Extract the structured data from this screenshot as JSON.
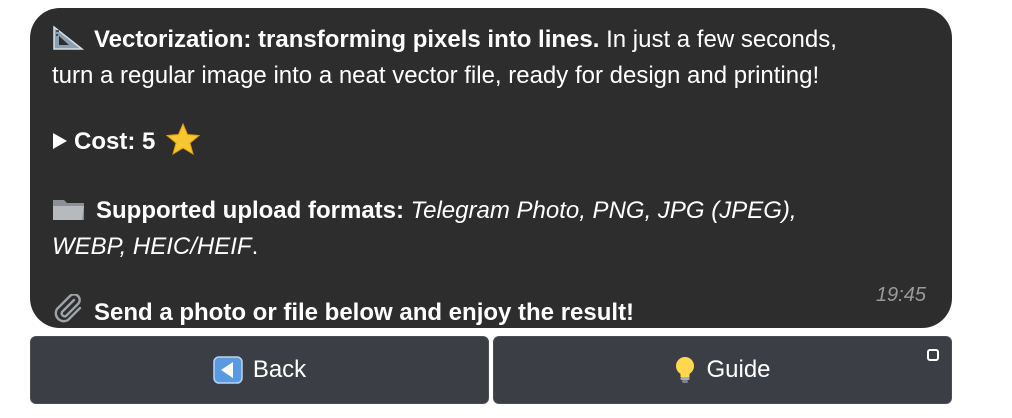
{
  "message": {
    "title_bold": "Vectorization: transforming pixels into lines.",
    "title_rest": " In just a few seconds,",
    "line2": "turn a regular image into a neat vector file, ready for design and printing!",
    "cost_label": "Cost: 5",
    "formats_label": "Supported upload formats:",
    "formats_line1": " Telegram Photo, PNG, JPG (JPEG),",
    "formats_line2": "WEBP, HEIC/HEIF",
    "formats_end": ".",
    "send_text": "Send a photo or file below and enjoy the result!",
    "time": "19:45",
    "icons": [
      "triangle-ruler-icon",
      "play-arrow-icon",
      "star-icon",
      "folder-icon",
      "paperclip-icon"
    ]
  },
  "keyboard": {
    "back_label": "Back",
    "guide_label": "Guide",
    "icons": [
      "back-arrow-icon",
      "light-bulb-icon"
    ]
  }
}
